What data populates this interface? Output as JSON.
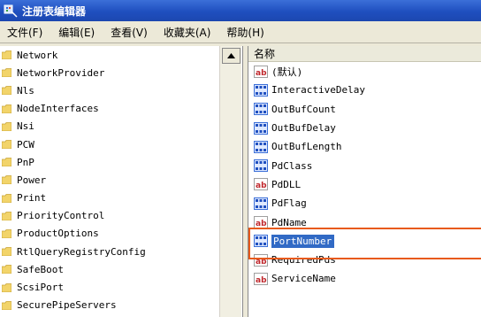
{
  "window": {
    "title": "注册表编辑器",
    "app_icon": "regedit-icon"
  },
  "menu": [
    {
      "label": "文件(F)"
    },
    {
      "label": "编辑(E)"
    },
    {
      "label": "查看(V)"
    },
    {
      "label": "收藏夹(A)"
    },
    {
      "label": "帮助(H)"
    }
  ],
  "tree": {
    "items": [
      {
        "label": "Network"
      },
      {
        "label": "NetworkProvider"
      },
      {
        "label": "Nls"
      },
      {
        "label": "NodeInterfaces"
      },
      {
        "label": "Nsi"
      },
      {
        "label": "PCW"
      },
      {
        "label": "PnP"
      },
      {
        "label": "Power"
      },
      {
        "label": "Print"
      },
      {
        "label": "PriorityControl"
      },
      {
        "label": "ProductOptions"
      },
      {
        "label": "RtlQueryRegistryConfig"
      },
      {
        "label": "SafeBoot"
      },
      {
        "label": "ScsiPort"
      },
      {
        "label": "SecurePipeServers"
      }
    ]
  },
  "values": {
    "column_name": "名称",
    "items": [
      {
        "name": "(默认)",
        "type": "string"
      },
      {
        "name": "InteractiveDelay",
        "type": "binary"
      },
      {
        "name": "OutBufCount",
        "type": "binary"
      },
      {
        "name": "OutBufDelay",
        "type": "binary"
      },
      {
        "name": "OutBufLength",
        "type": "binary"
      },
      {
        "name": "PdClass",
        "type": "binary"
      },
      {
        "name": "PdDLL",
        "type": "string"
      },
      {
        "name": "PdFlag",
        "type": "binary"
      },
      {
        "name": "PdName",
        "type": "string"
      },
      {
        "name": "PortNumber",
        "type": "binary",
        "selected": true
      },
      {
        "name": "RequiredPds",
        "type": "string"
      },
      {
        "name": "ServiceName",
        "type": "string"
      }
    ]
  },
  "colors": {
    "selection": "#316ac5",
    "highlight_box": "#e85a1c",
    "titlebar": "#1f4fbf"
  }
}
